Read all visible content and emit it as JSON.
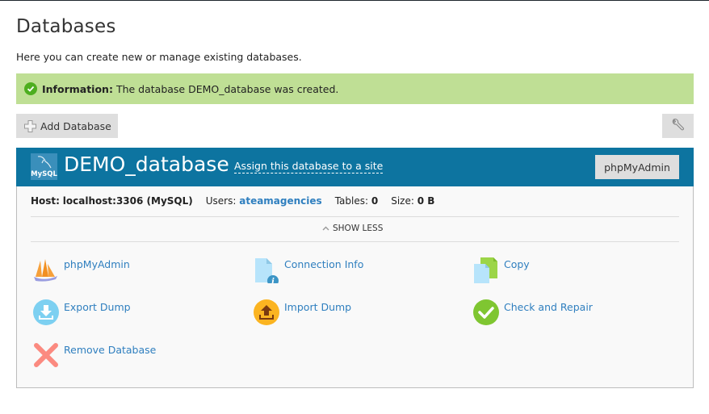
{
  "page": {
    "title": "Databases",
    "description": "Here you can create new or manage existing databases."
  },
  "message": {
    "label": "Information:",
    "text": "The database DEMO_database was created.",
    "icon": "check-circle-icon",
    "color": "#bfdf95"
  },
  "toolbar": {
    "add_label": "Add Database",
    "settings_icon": "wrench-icon"
  },
  "database": {
    "logo_text": "MySQL",
    "name": "DEMO_database",
    "assign_label": "Assign this database to a site",
    "phpmyadmin_button": "phpMyAdmin",
    "header_color": "#0d74a0",
    "host_label": "Host:",
    "host_value": "localhost:3306 (MySQL)",
    "users_label": "Users:",
    "users_value": "ateamagencies",
    "tables_label": "Tables:",
    "tables_value": "0",
    "size_label": "Size:",
    "size_value": "0 B",
    "toggle_label": "SHOW LESS"
  },
  "actions": [
    {
      "label": "phpMyAdmin",
      "icon": "phpmyadmin-sailboat-icon"
    },
    {
      "label": "Connection Info",
      "icon": "document-info-icon"
    },
    {
      "label": "Copy",
      "icon": "copy-icon"
    },
    {
      "label": "Export Dump",
      "icon": "export-download-icon"
    },
    {
      "label": "Import Dump",
      "icon": "import-upload-icon"
    },
    {
      "label": "Check and Repair",
      "icon": "check-repair-icon"
    },
    {
      "label": "Remove Database",
      "icon": "remove-x-icon"
    }
  ]
}
